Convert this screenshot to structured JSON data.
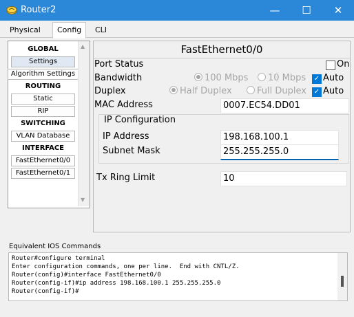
{
  "window": {
    "title": "Router2",
    "controls": {
      "minimize": "—",
      "maximize": "☐",
      "close": "✕"
    }
  },
  "tabs": [
    {
      "label": "Physical",
      "active": false
    },
    {
      "label": "Config",
      "active": true
    },
    {
      "label": "CLI",
      "active": false
    }
  ],
  "sidebar": {
    "items": [
      {
        "type": "header",
        "label": "GLOBAL"
      },
      {
        "type": "button",
        "label": "Settings",
        "selected": true
      },
      {
        "type": "button",
        "label": "Algorithm Settings"
      },
      {
        "type": "header",
        "label": "ROUTING"
      },
      {
        "type": "button",
        "label": "Static"
      },
      {
        "type": "button",
        "label": "RIP"
      },
      {
        "type": "header",
        "label": "SWITCHING"
      },
      {
        "type": "button",
        "label": "VLAN Database"
      },
      {
        "type": "header",
        "label": "INTERFACE"
      },
      {
        "type": "button",
        "label": "FastEthernet0/0"
      },
      {
        "type": "button",
        "label": "FastEthernet0/1"
      }
    ]
  },
  "panel": {
    "title": "FastEthernet0/0",
    "port_status": {
      "label": "Port Status",
      "option": "On",
      "checked": false
    },
    "bandwidth": {
      "label": "Bandwidth",
      "opt1": "100 Mbps",
      "opt2": "10 Mbps",
      "auto": "Auto",
      "auto_checked": true
    },
    "duplex": {
      "label": "Duplex",
      "opt1": "Half Duplex",
      "opt2": "Full Duplex",
      "auto": "Auto",
      "auto_checked": true
    },
    "mac": {
      "label": "MAC Address",
      "value": "0007.EC54.DD01"
    },
    "ip_config": {
      "title": "IP Configuration",
      "ip_label": "IP Address",
      "ip_value": "198.168.100.1",
      "mask_label": "Subnet Mask",
      "mask_value": "255.255.255.0"
    },
    "tx_ring": {
      "label": "Tx Ring Limit",
      "value": "10"
    }
  },
  "ios": {
    "label": "Equivalent IOS Commands",
    "lines": [
      "Router#configure terminal",
      "Enter configuration commands, one per line.  End with CNTL/Z.",
      "Router(config)#interface FastEthernet0/0",
      "Router(config-if)#ip address 198.168.100.1 255.255.255.0",
      "Router(config-if)#"
    ]
  },
  "colors": {
    "titlebar": "#2b88d8",
    "accent": "#0078d7"
  }
}
